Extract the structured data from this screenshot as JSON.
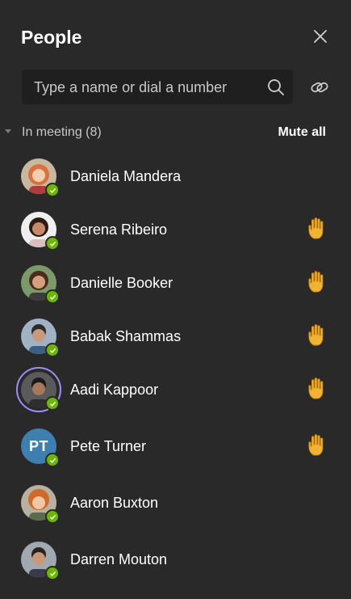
{
  "header": {
    "title": "People"
  },
  "search": {
    "placeholder": "Type a name or dial a number"
  },
  "section": {
    "label": "In meeting (8)",
    "mute_all": "Mute all"
  },
  "colors": {
    "background": "#292929",
    "presence_available": "#6bb700",
    "hand_raised": "#f2b233",
    "speaking_ring": "#9b8ef5"
  },
  "participants": [
    {
      "name": "Daniela Mandera",
      "hand_raised": false,
      "speaking": false,
      "initials": ""
    },
    {
      "name": "Serena Ribeiro",
      "hand_raised": true,
      "speaking": false,
      "initials": ""
    },
    {
      "name": "Danielle Booker",
      "hand_raised": true,
      "speaking": false,
      "initials": ""
    },
    {
      "name": "Babak Shammas",
      "hand_raised": true,
      "speaking": false,
      "initials": ""
    },
    {
      "name": "Aadi Kappoor",
      "hand_raised": true,
      "speaking": true,
      "initials": ""
    },
    {
      "name": "Pete Turner",
      "hand_raised": true,
      "speaking": false,
      "initials": "PT"
    },
    {
      "name": "Aaron Buxton",
      "hand_raised": false,
      "speaking": false,
      "initials": ""
    },
    {
      "name": "Darren Mouton",
      "hand_raised": false,
      "speaking": false,
      "initials": ""
    }
  ]
}
